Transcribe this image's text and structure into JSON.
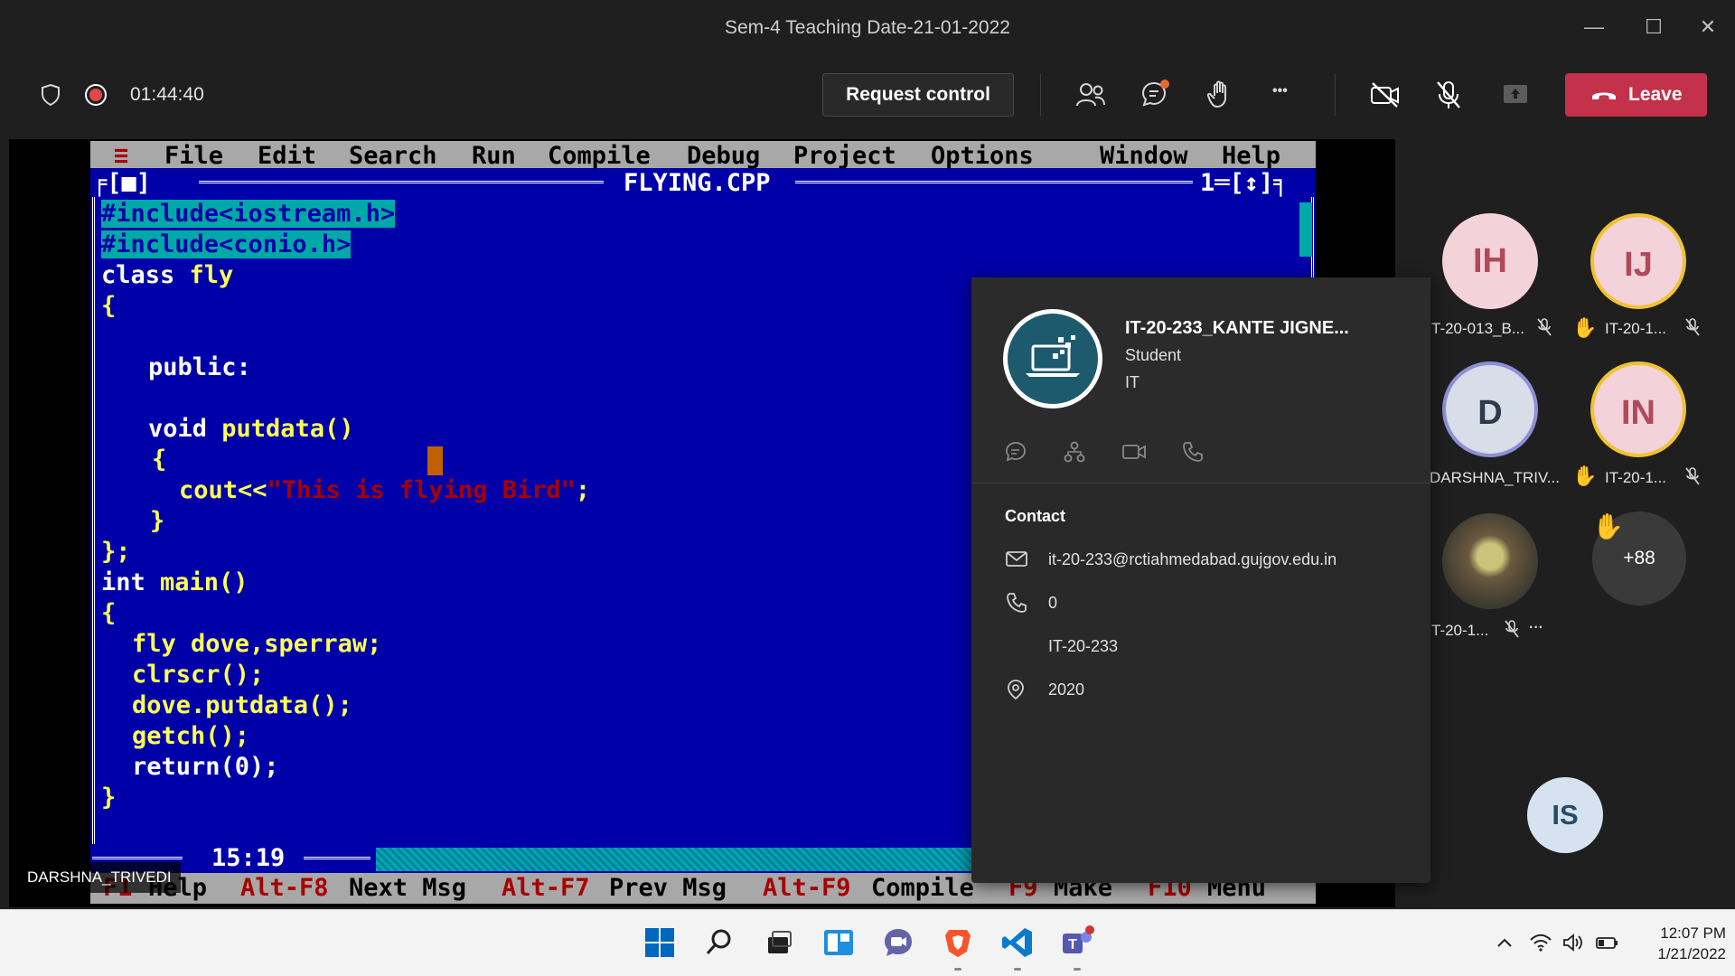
{
  "window": {
    "title": "Sem-4 Teaching Date-21-01-2022",
    "minimize_glyph": "—",
    "maximize_glyph": "☐",
    "close_glyph": "✕"
  },
  "toolbar": {
    "timer": "01:44:40",
    "request_control_label": "Request control",
    "more_glyph": "•••",
    "leave_label": "Leave",
    "leave_color": "#c4314b"
  },
  "turbo_c": {
    "menu": {
      "sys": "≡",
      "file": "File",
      "edit": "Edit",
      "search": "Search",
      "run": "Run",
      "compile": "Compile",
      "debug": "Debug",
      "project": "Project",
      "options": "Options",
      "window": "Window",
      "help": "Help"
    },
    "frame_left": "╒[■]",
    "filename": "FLYING.CPP",
    "frame_right": "1═[↕]╕",
    "code": {
      "l1": "#include<iostream.h>",
      "l2": "#include<conio.h>",
      "l3_kw": "class ",
      "l3_id": "fly",
      "l4": "{",
      "l5": "public:",
      "l6_kw": "void ",
      "l6_id": "putdata()",
      "l7": "{",
      "l8_a": "cout<<",
      "l8_str": "\"This is flying Bird\"",
      "l8_b": ";",
      "l9": "}",
      "l10": "};",
      "l11_kw": "int ",
      "l11_id": "main()",
      "l12": "{",
      "l13": "fly dove,sperraw;",
      "l14": "clrscr();",
      "l15": "dove.putdata();",
      "l16": "getch();",
      "l17": "return(0);",
      "l18": "}"
    },
    "position": "15:19",
    "status": {
      "f1": "F1",
      "help": "Help",
      "altf8": "Alt-F8",
      "next_msg": "Next Msg",
      "altf7": "Alt-F7",
      "prev_msg": "Prev Msg",
      "altf9": "Alt-F9",
      "compile": "Compile",
      "f9": "F9",
      "make": "Make",
      "f10": "F10",
      "menu": "Menu"
    }
  },
  "speaker_label": "DARSHNA_TRIVEDI",
  "participants": [
    {
      "initials": "IH",
      "name": "T-20-013_B...",
      "hand": false
    },
    {
      "initials": "IJ",
      "name": "IT-20-1...",
      "hand": true
    },
    {
      "initials": "D",
      "name": "DARSHNA_TRIV...",
      "hand": false
    },
    {
      "initials": "IN",
      "name": "IT-20-1...",
      "hand": true
    },
    {
      "initials": "",
      "name": "T-20-1...",
      "hand": false
    },
    {
      "initials": "+88",
      "name": "",
      "hand": true
    }
  ],
  "self_view_initials": "IS",
  "profile_card": {
    "name": "IT-20-233_KANTE JIGNE...",
    "role": "Student",
    "department": "IT",
    "contact_heading": "Contact",
    "email": "it-20-233@rctiahmedabad.gujgov.edu.in",
    "phone": "0",
    "id": "IT-20-233",
    "location": "2020"
  },
  "taskbar": {
    "time": "12:07 PM",
    "date": "1/21/2022"
  }
}
